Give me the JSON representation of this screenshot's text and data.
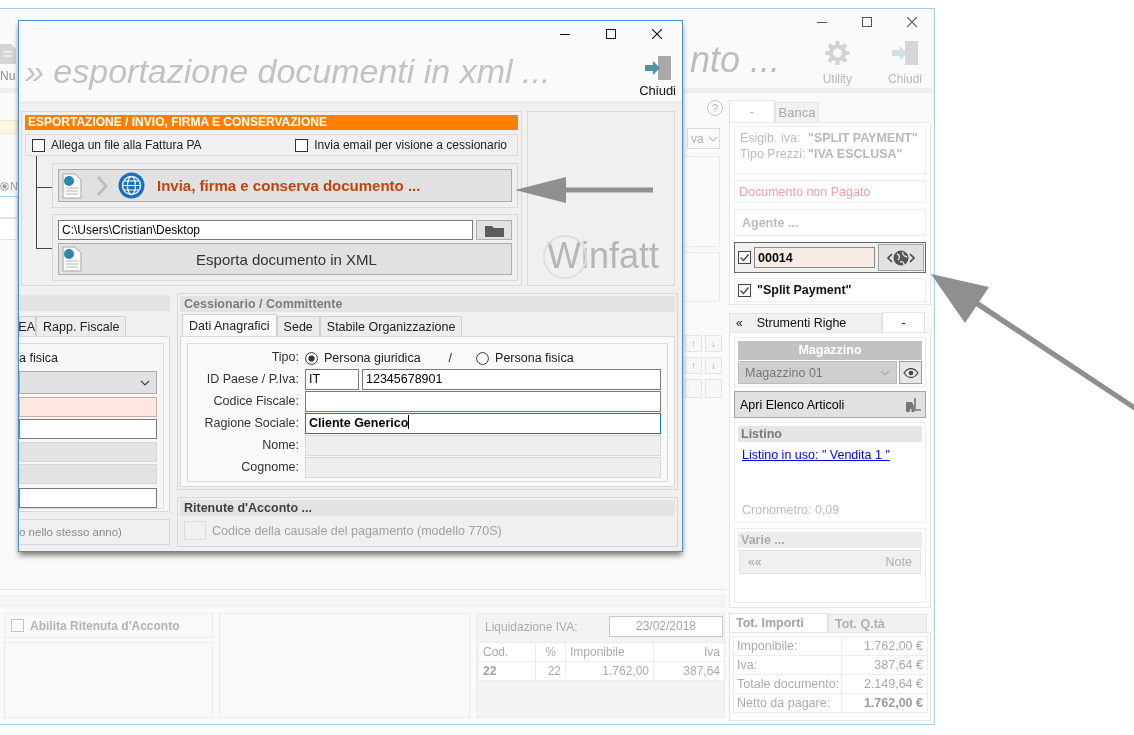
{
  "main_window": {
    "toolbar": {
      "new_label": "Nu",
      "title": "nto ...",
      "utility_label": "Utility",
      "close_label": "Chiudi"
    },
    "left_strip": {
      "radio": {
        "label": "N",
        "selected": true
      }
    },
    "right_strip": {
      "help_glyph": "?",
      "dropdown_value": "va",
      "move_buttons": [
        {
          "up": "↑",
          "down": "↓"
        },
        {
          "up": "↑",
          "down": "↓"
        }
      ]
    },
    "side_panel": {
      "tabs": [
        {
          "label": "-",
          "selected": true
        },
        {
          "label": "Banca",
          "selected": false
        }
      ],
      "vat_info": [
        {
          "label": "Esigib. iva:",
          "value": "\"SPLIT PAYMENT\""
        },
        {
          "label": "Tipo Prezzi:",
          "value": "\"IVA ESCLUSA\""
        }
      ],
      "payment_status": "Documento non Pagato",
      "agent": "Agente ...",
      "document_number": {
        "checked": true,
        "value": "00014"
      },
      "split_payment": {
        "checked": true,
        "label": "\"Split Payment\""
      },
      "tool_tabs": [
        {
          "glyph": "«",
          "label": "Strumenti Righe",
          "selected": false
        },
        {
          "label": "-",
          "selected": true
        }
      ],
      "warehouse": {
        "title": "Magazzino",
        "value": "Magazzino 01"
      },
      "articles_button": "Apri Elenco Articoli",
      "price_list": {
        "title": "Listino",
        "link": "Listino in uso: \" Vendita 1 \"",
        "timer": "Cronometro: 0,09"
      },
      "misc": {
        "title": "Varie ...",
        "button_glyph": "««",
        "button_label": "Note"
      },
      "totals_tabs": [
        {
          "label": "Tot. Importi",
          "selected": true
        },
        {
          "label": "Tot. Q.tà",
          "selected": false
        }
      ],
      "totals": [
        {
          "label": "Imponibile:",
          "value": "1.762,00 €",
          "bold": false
        },
        {
          "label": "Iva:",
          "value": "387,64 €",
          "bold": false
        },
        {
          "label": "Totale documento:",
          "value": "2.149,64 €",
          "bold": false
        },
        {
          "label": "Netto da pagare:",
          "value": "1.762,00 €",
          "bold": true
        }
      ]
    },
    "bottom": {
      "withholding": {
        "checked": false,
        "label": "Abilita Ritenuta d'Acconto"
      },
      "vat_settlement": {
        "label": "Liquidazione IVA:",
        "date": "23/02/2018"
      },
      "vat_table": {
        "columns": [
          "Cod.",
          "%",
          "Imponibile",
          "Iva"
        ],
        "rows": [
          [
            "22",
            "22",
            "1.762,00",
            "387,64"
          ]
        ]
      }
    }
  },
  "dialog": {
    "title": "» esportazione documenti in xml ...",
    "close_label": "Chiudi",
    "export": {
      "header": "ESPORTAZIONE / INVIO, FIRMA E CONSERVAZIONE",
      "options": [
        {
          "label": "Allega un file alla Fattura PA",
          "checked": false
        },
        {
          "label": "Invia email per visione a cessionario",
          "checked": false
        }
      ],
      "send_button": "Invia, firma e conserva documento ...",
      "path": "C:\\Users\\Cristian\\Desktop",
      "export_button": "Esporta documento in XML"
    },
    "logo": "Winfatt",
    "left_panel": {
      "tabs": [
        {
          "label": "EA",
          "selected": false
        },
        {
          "label": "Rapp. Fiscale",
          "selected": false
        }
      ],
      "radio_label": "a fisica",
      "fields": [
        {
          "kind": "select",
          "disabled": false,
          "required": false
        },
        {
          "kind": "text",
          "disabled": false,
          "required": true
        },
        {
          "kind": "text",
          "disabled": false,
          "required": false
        },
        {
          "kind": "text",
          "disabled": true,
          "required": false
        },
        {
          "kind": "text",
          "disabled": true,
          "required": false
        },
        {
          "kind": "text",
          "disabled": false,
          "required": false
        }
      ],
      "footer": "o nello stesso anno)"
    },
    "recipient": {
      "title": "Cessionario / Committente",
      "tabs": [
        {
          "label": "Dati Anagrafici",
          "selected": true
        },
        {
          "label": "Sede",
          "selected": false
        },
        {
          "label": "Stabile Organizzazione",
          "selected": false
        }
      ],
      "type": {
        "label": "Tipo:",
        "separator": "/",
        "options": [
          {
            "label": "Persona giuridica",
            "selected": true
          },
          {
            "label": "Persona fisica",
            "selected": false
          }
        ]
      },
      "fields": [
        {
          "label": "ID Paese / P.Iva:",
          "kind": "split",
          "prefix": "IT",
          "value": "12345678901",
          "disabled": false,
          "focused": false
        },
        {
          "label": "Codice Fiscale:",
          "kind": "text",
          "disabled": false,
          "focused": false
        },
        {
          "label": "Ragione Sociale:",
          "kind": "text",
          "value": "Cliente Generico",
          "disabled": false,
          "focused": true
        },
        {
          "label": "Nome:",
          "kind": "text",
          "disabled": true,
          "focused": false
        },
        {
          "label": "Cognome:",
          "kind": "text",
          "disabled": true,
          "focused": false
        }
      ]
    },
    "withholding": {
      "title": "Ritenute d'Acconto ...",
      "code_label": "Codice della causale del pagamento (modello 770S)",
      "disabled": true
    }
  }
}
